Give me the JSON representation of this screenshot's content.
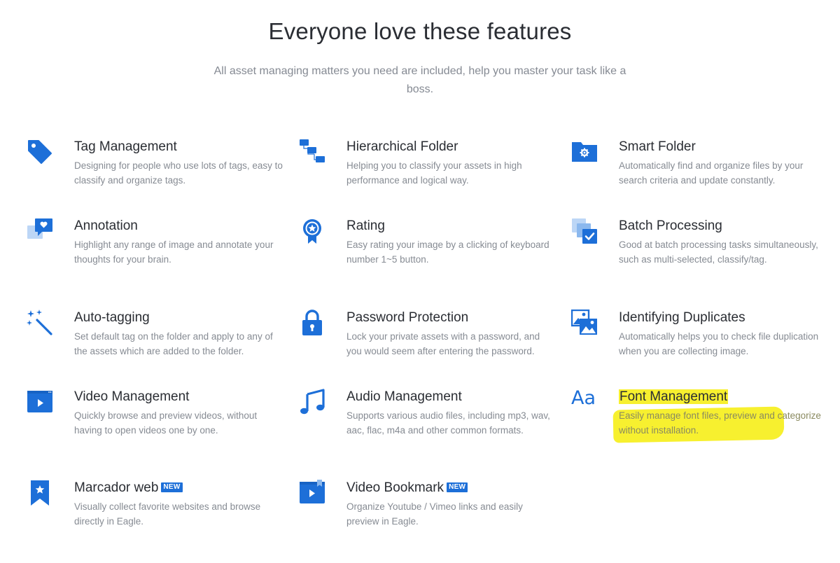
{
  "header": {
    "title": "Everyone love these features",
    "subtitle": "All asset managing matters you need are included, help you master your task like a boss."
  },
  "colors": {
    "accent": "#1d6fd8",
    "highlight": "#f7f02f"
  },
  "features": [
    {
      "title": "Tag Management",
      "desc": "Designing for people who use lots of tags, easy to classify and organize tags.",
      "icon": "tag-icon"
    },
    {
      "title": "Hierarchical Folder",
      "desc": "Helping you to classify your assets in high performance and logical way.",
      "icon": "folder-tree-icon"
    },
    {
      "title": "Smart Folder",
      "desc": "Automatically find and organize files by your search criteria and update constantly.",
      "icon": "smart-folder-icon"
    },
    {
      "title": "Annotation",
      "desc": "Highlight any range of image and annotate your thoughts for your brain.",
      "icon": "annotation-icon"
    },
    {
      "title": "Rating",
      "desc": "Easy rating your image by a clicking of keyboard number 1~5 button.",
      "icon": "rating-badge-icon"
    },
    {
      "title": "Batch Processing",
      "desc": "Good at batch processing tasks simultaneously, such as multi-selected, classify/tag.",
      "icon": "batch-check-icon"
    },
    {
      "title": "Auto-tagging",
      "desc": "Set default tag on the folder and apply to any of the assets which are added to the folder.",
      "icon": "magic-wand-icon"
    },
    {
      "title": "Password Protection",
      "desc": "Lock your private assets with a password, and you would seem after entering the password.",
      "icon": "lock-icon"
    },
    {
      "title": "Identifying Duplicates",
      "desc": "Automatically helps you to check file duplication when you are collecting image.",
      "icon": "duplicate-images-icon"
    },
    {
      "title": "Video Management",
      "desc": "Quickly browse and preview videos, without having to open videos one by one.",
      "icon": "video-player-icon"
    },
    {
      "title": "Audio Management",
      "desc": "Supports various audio files, including mp3, wav, aac, flac, m4a and other common formats.",
      "icon": "music-note-icon"
    },
    {
      "title": "Font Management",
      "desc": "Easily manage font files, preview and categorize without installation.",
      "icon": "font-aa-icon",
      "icon_text": "Aa"
    },
    {
      "title": "Marcador web",
      "desc": "Visually collect favorite websites and browse directly in Eagle.",
      "icon": "bookmark-star-icon",
      "badge": "NEW"
    },
    {
      "title": "Video Bookmark",
      "desc": "Organize Youtube / Vimeo links and easily preview in Eagle.",
      "icon": "video-bookmark-icon",
      "badge": "NEW"
    }
  ]
}
